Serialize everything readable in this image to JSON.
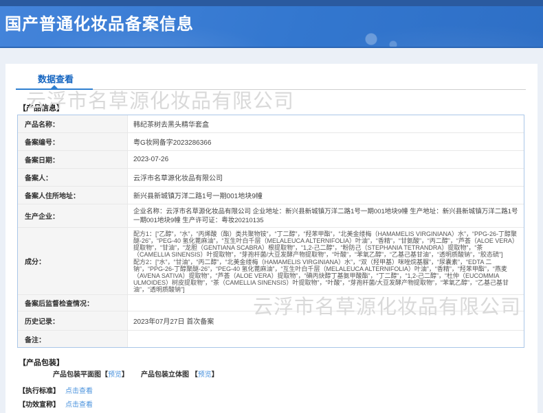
{
  "header": {
    "title": "国产普通化妆品备案信息"
  },
  "tabs": {
    "data_view": "数据查看"
  },
  "watermark": {
    "text": "云浮市名草源化妆品有限公司"
  },
  "product_info": {
    "section_title": "【产品信息】",
    "rows": [
      {
        "label": "产品名称：",
        "value": "韩纪茶树去黑头精华套盒"
      },
      {
        "label": "备案编号：",
        "value": "粤G妆网备字2023286366"
      },
      {
        "label": "备案日期：",
        "value": "2023-07-26"
      },
      {
        "label": "备案人：",
        "value": "云浮市名草源化妆品有限公司"
      },
      {
        "label": "备案人住所地址：",
        "value": "新兴县新城镇万洋二路1号一期001地块9幢"
      },
      {
        "label": "生产企业：",
        "value": "企业名称：云浮市名草源化妆品有限公司 企业地址：新兴县新城镇万洋二路1号一期001地块9幢 生产地址：新兴县新城镇万洋二路1号一期001地块9幢 生产许可证：粤妆20210135"
      },
      {
        "label": "成分：",
        "formula1": "配方1：[“乙醇”，“水”，“丙烯酸（酯）类共聚物铵”，“丁二醇”，“羟苯甲酯”，“北美金缕梅（HAMAMELIS VIRGINIANA）水”，“PPG-26-丁醇聚醚-26”，“PEG-40 氢化蓖麻油”，“互生叶白千层（MELALEUCA ALTERNIFOLIA）叶油”，“香精”，“甘氨酸”，“丙二醇”，“芦荟（ALOE VERA）提取物”，“甘油”，“龙胆（GENTIANA SCABRA）根提取物”，“1,2-己二醇”，“粉防己（STEPHANIA TETRANDRA）提取物”，“茶（CAMELLIA SINENSIS）叶提取物”，“芽孢杆菌/大豆发酵产物提取物”，“叶酸”，“苯氧乙醇”，“乙基己基甘油”，“透明质酸钠”，“胶态硫”]",
        "formula2": "配方2：[“水”，“甘油”，“丙二醇”，“北美金缕梅（HAMAMELIS VIRGINIANA）水”，“双（羟甲基）咪唑烷基脲”，“尿囊素”，“EDTA 二钠”，“PPG-26-丁醇聚醚-26”，“PEG-40 氢化蓖麻油”，“互生叶白千层（MELALEUCA ALTERNIFOLIA）叶油”，“香精”，“羟苯甲酯”，“燕麦（AVENA SATIVA）提取物”，“芦荟（ALOE VERA）提取物”，“碘丙炔醇丁基氨甲酸酯”，“丁二醇”，“1,2-己二醇”，“杜仲（EUCOMMIA ULMOIDES）树皮提取物”，“茶（CAMELLIA SINENSIS）叶提取物”，“叶酸”，“芽孢杆菌/大豆发酵产物提取物”，“苯氧乙醇”，“乙基己基甘油”，“透明质酸钠”]"
      },
      {
        "label": "备案后监督检查情况：",
        "value": ""
      },
      {
        "label": "历史记录：",
        "value": "2023年07月27日 首次备案"
      },
      {
        "label": "备注：",
        "value": ""
      }
    ]
  },
  "packaging": {
    "section_title": "【产品包装】",
    "items": [
      {
        "label": "产品包装平面图",
        "bracket_open": "【",
        "link": "预览",
        "bracket_close": "】"
      },
      {
        "label": "产品包装立体图 ",
        "bracket_open": "【",
        "link": "预览",
        "bracket_close": "】"
      }
    ]
  },
  "footer_links": [
    {
      "label": "【执行标准】",
      "link": "点击查看"
    },
    {
      "label": "【功效宣称】",
      "link": "点击查看"
    }
  ],
  "colors": {
    "header_blue": "#3377cf",
    "header_strip_blue": "#2a5a9f",
    "tab_blue": "#1565c0",
    "link_blue": "#4b93dd",
    "table_border_blue": "#a9c6e8",
    "label_cell_gray": "#f5f5f5",
    "watermark_gray": "#d9d9d9",
    "page_bg": "#ebf0f7"
  }
}
